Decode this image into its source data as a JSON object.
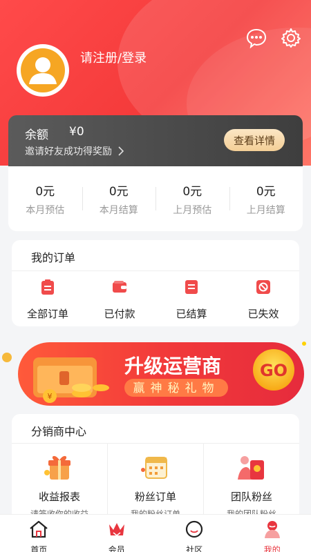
{
  "header": {
    "login_text": "请注册/登录",
    "icons": [
      "message-icon",
      "settings-icon"
    ],
    "accent_color": "#f43a3a"
  },
  "balance": {
    "label": "余额",
    "amount": "¥0",
    "invite_text": "邀请好友成功得奖励",
    "detail_button": "查看详情"
  },
  "stats": [
    {
      "value": "0元",
      "label": "本月预估"
    },
    {
      "value": "0元",
      "label": "本月结算"
    },
    {
      "value": "0元",
      "label": "上月预估"
    },
    {
      "value": "0元",
      "label": "上月结算"
    }
  ],
  "orders": {
    "title": "我的订单",
    "items": [
      {
        "label": "全部订单",
        "icon": "clipboard-icon"
      },
      {
        "label": "已付款",
        "icon": "wallet-icon"
      },
      {
        "label": "已结算",
        "icon": "list-icon"
      },
      {
        "label": "已失效",
        "icon": "invalid-icon"
      }
    ]
  },
  "promo": {
    "title": "升级运营商",
    "subtitle": "赢神秘礼物",
    "go": "GO"
  },
  "distributor": {
    "title": "分销商中心",
    "items": [
      {
        "label": "收益报表",
        "sub": "请签收你的收益",
        "icon": "gift-box-icon"
      },
      {
        "label": "粉丝订单",
        "sub": "我的粉丝订单",
        "icon": "calendar-icon"
      },
      {
        "label": "团队粉丝",
        "sub": "我的团队粉丝",
        "icon": "red-envelope-icon"
      }
    ]
  },
  "tabbar": {
    "items": [
      {
        "label": "首页",
        "icon": "home-icon"
      },
      {
        "label": "会员",
        "icon": "crown-icon"
      },
      {
        "label": "社区",
        "icon": "community-icon"
      },
      {
        "label": "我的",
        "icon": "profile-icon"
      }
    ],
    "active": "我的"
  }
}
